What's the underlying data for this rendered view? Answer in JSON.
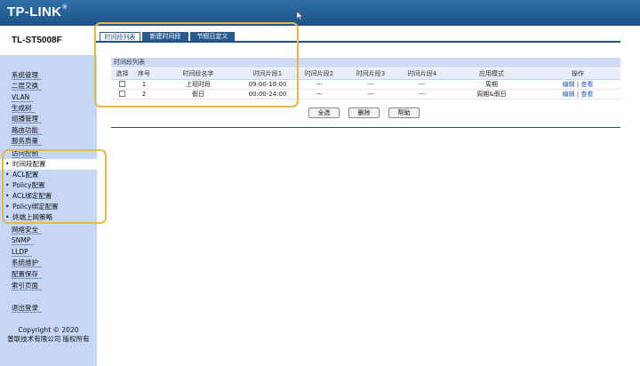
{
  "header": {
    "logo": "TP-LINK",
    "logo_mark": "®"
  },
  "sidebar": {
    "model": "TL-ST5008F",
    "items": [
      {
        "label": "系统管理"
      },
      {
        "label": "二层交换"
      },
      {
        "label": "VLAN"
      },
      {
        "label": "生成树"
      },
      {
        "label": "组播管理"
      },
      {
        "label": "路由功能"
      },
      {
        "label": "服务质量"
      },
      {
        "label": "访问控制"
      }
    ],
    "subitems": [
      {
        "label": "时间段配置"
      },
      {
        "label": "ACL配置"
      },
      {
        "label": "Policy配置"
      },
      {
        "label": "ACL绑定配置"
      },
      {
        "label": "Policy绑定配置"
      },
      {
        "label": "终端上网策略"
      }
    ],
    "items2": [
      {
        "label": "网络安全"
      },
      {
        "label": "SNMP"
      },
      {
        "label": "LLDP"
      },
      {
        "label": "系统维护"
      },
      {
        "label": "配置保存"
      },
      {
        "label": "索引页面"
      }
    ],
    "logout": "退出登录",
    "copyright_line1": "Copyright © 2020",
    "copyright_line2": "普联技术有限公司 版权所有"
  },
  "tabs": [
    {
      "label": "时间段列表"
    },
    {
      "label": "新建时间段"
    },
    {
      "label": "节假日定义"
    }
  ],
  "section_title": "时间段列表",
  "table": {
    "headers": [
      "选择",
      "序号",
      "时间段名字",
      "时间片段1",
      "时间片段2",
      "时间片段3",
      "时间片段4",
      "应用模式",
      "操作"
    ],
    "rows": [
      {
        "index": "1",
        "name": "上班时段",
        "slot1": "09:00-18:00",
        "slot2": "---",
        "slot3": "---",
        "slot4": "---",
        "mode": "周期",
        "edit": "编辑",
        "sep": "|",
        "view": "查看"
      },
      {
        "index": "2",
        "name": "假日",
        "slot1": "00:00-24:00",
        "slot2": "---",
        "slot3": "---",
        "slot4": "---",
        "mode": "周期&假日",
        "edit": "编辑",
        "sep": "|",
        "view": "查看"
      }
    ]
  },
  "buttons": {
    "select_all": "全选",
    "delete": "删除",
    "help": "帮助"
  },
  "colors": {
    "header_bg": "#1f5489",
    "sidebar_bg": "#c5d7f5",
    "link": "#1d56c8",
    "highlight": "#e7b648"
  },
  "icons": {
    "cursor": "mouse-pointer-icon"
  }
}
